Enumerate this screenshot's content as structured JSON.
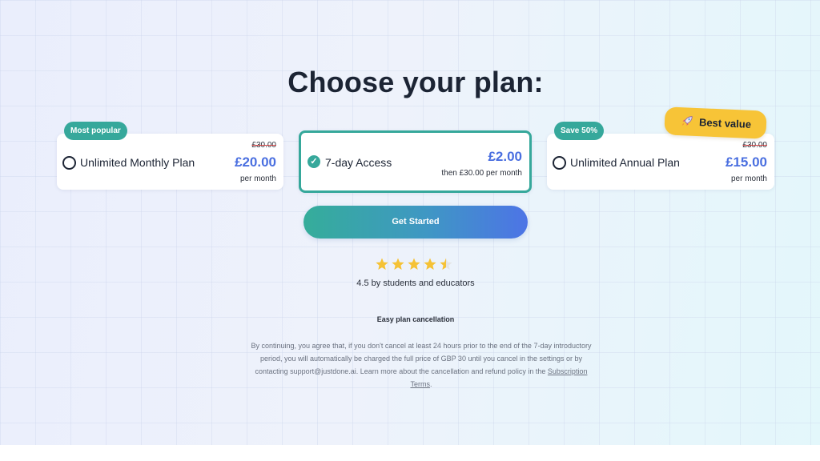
{
  "heading": "Choose your plan:",
  "plans": [
    {
      "badge": "Most popular",
      "name": "Unlimited Monthly Plan",
      "old_price": "£30.00",
      "price": "£20.00",
      "period": "per month",
      "selected": false
    },
    {
      "name": "7-day Access",
      "price": "£2.00",
      "period": "then £30.00 per month",
      "selected": true
    },
    {
      "badge": "Save 50%",
      "name": "Unlimited Annual Plan",
      "old_price": "£30.00",
      "price": "£15.00",
      "period": "per month",
      "selected": false,
      "highlight": "Best value"
    }
  ],
  "cta_label": "Get Started",
  "rating": {
    "value": 4.5,
    "max": 5,
    "text": "4.5 by students and educators"
  },
  "cancellation_title": "Easy plan cancellation",
  "legal": {
    "text": "By continuing, you agree that, if you don't cancel at least 24 hours prior to the end of the 7-day introductory period, you will automatically be charged the full price of GBP 30 until you cancel in the settings or by contacting support@justdone.ai. Learn more about the cancellation and refund policy in the ",
    "link": "Subscription Terms",
    "end": "."
  },
  "icons": {
    "radio_unchecked": "radio-empty-icon",
    "radio_checked": "check-circle-icon",
    "best_value": "rocket-icon",
    "rating": "star-icon"
  },
  "colors": {
    "accent_teal": "#36a89b",
    "price_blue": "#4a6fe0",
    "best_value_yellow": "#f7c437",
    "star": "#f5c236"
  }
}
